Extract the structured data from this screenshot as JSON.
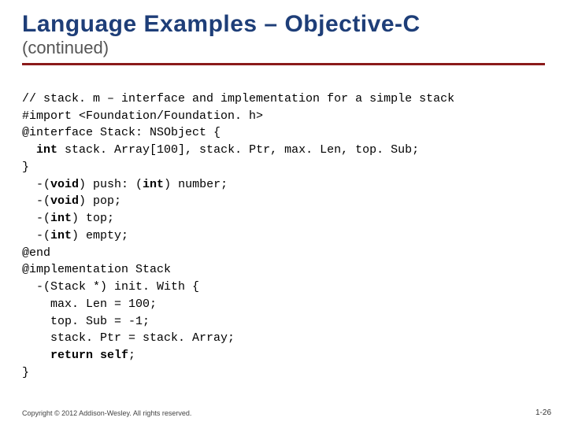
{
  "header": {
    "title": "Language Examples – Objective-C",
    "subtitle": "(continued)"
  },
  "code": {
    "l01": "// stack. m – interface and implementation for a simple stack",
    "l02": "#import <Foundation/Foundation. h>",
    "l03_a": "@interface Stack: NSObject {",
    "l04_pre": "  ",
    "l04_kw": "int",
    "l04_rest": " stack. Array[100], stack. Ptr, max. Len, top. Sub;",
    "l05": "}",
    "l06_pre": "  -(",
    "l06_kw": "void",
    "l06_mid": ") push: (",
    "l06_kw2": "int",
    "l06_end": ") number;",
    "l07_pre": "  -(",
    "l07_kw": "void",
    "l07_end": ") pop;",
    "l08_pre": "  -(",
    "l08_kw": "int",
    "l08_end": ") top;",
    "l09_pre": "  -(",
    "l09_kw": "int",
    "l09_end": ") empty;",
    "l10": "@end",
    "l11": "@implementation Stack",
    "l12": "  -(Stack *) init. With {",
    "l13": "    max. Len = 100;",
    "l14": "    top. Sub = -1;",
    "l15": "    stack. Ptr = stack. Array;",
    "l16_pre": "    ",
    "l16_kw": "return self",
    "l16_end": ";",
    "l17": "}"
  },
  "footer": {
    "copyright": "Copyright © 2012 Addison-Wesley. All rights reserved.",
    "page": "1-26"
  }
}
